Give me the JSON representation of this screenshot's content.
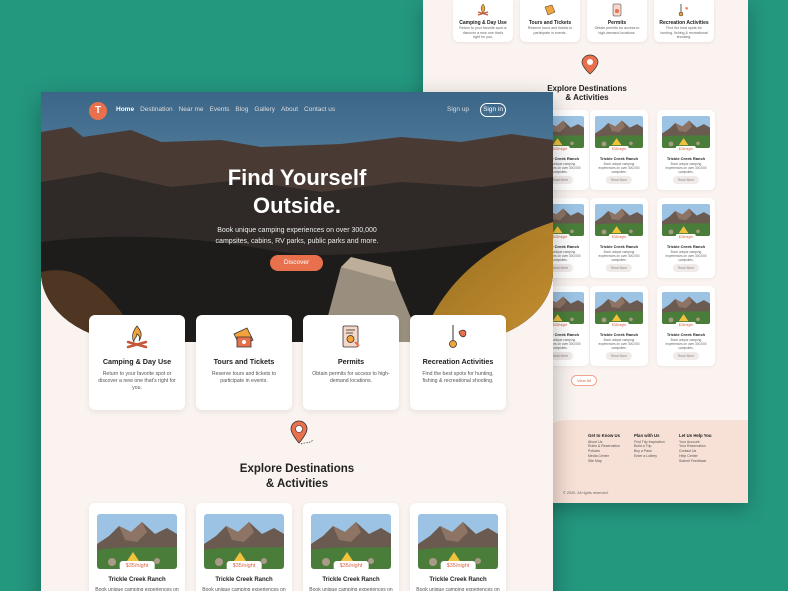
{
  "nav": {
    "logo_letter": "T",
    "items": [
      "Home",
      "Destination",
      "Near me",
      "Events",
      "Blog",
      "Gallery",
      "About",
      "Contact us"
    ],
    "sign_up": "Sign up",
    "sign_in": "Sign in"
  },
  "hero": {
    "title_line1": "Find Yourself",
    "title_line2": "Outside.",
    "subtitle": "Book unique camping experiences on over 300,000 campsites, cabins, RV parks, public parks and more.",
    "cta": "Discover"
  },
  "features": [
    {
      "title": "Camping & Day Use",
      "desc": "Return to your favorite spot or discover a new one that's right for you.",
      "icon": "campfire-icon"
    },
    {
      "title": "Tours and Tickets",
      "desc": "Reserve tours and tickets to participate in events.",
      "icon": "ticket-icon"
    },
    {
      "title": "Permits",
      "desc": "Obtain permits for access to high-demand locations.",
      "icon": "permit-icon"
    },
    {
      "title": "Recreation Activities",
      "desc": "Find the best spots for hunting, fishing & recreational shooting.",
      "icon": "fishing-icon"
    }
  ],
  "explore": {
    "title_line1": "Explore Destinations",
    "title_line2": "& Activities",
    "cards": [
      {
        "price": "$35/night",
        "name": "Trickle Creek Ranch",
        "desc": "Book unique camping experiences on"
      },
      {
        "price": "$35/night",
        "name": "Trickle Creek Ranch",
        "desc": "Book unique camping experiences on"
      },
      {
        "price": "$35/night",
        "name": "Trickle Creek Ranch",
        "desc": "Book unique camping experiences on"
      },
      {
        "price": "$35/night",
        "name": "Trickle Creek Ranch",
        "desc": "Book unique camping experiences on"
      }
    ]
  },
  "back_page": {
    "explore_title_line1": "Explore Destinations",
    "explore_title_line2": "& Activities",
    "card_price": "$35/night",
    "card_name": "Trickle Creek Ranch",
    "card_desc": "Book unique camping experiences on over 300,000 campsites.",
    "read_more": "Read More",
    "view_all": "View All",
    "footer": {
      "col1_title": "Get to Know Us",
      "col1_items": [
        "About Us",
        "Rules & Reservation",
        "Policies",
        "Media Center",
        "Site Map"
      ],
      "col2_title": "Plan with Us",
      "col2_items": [
        "Find Trip Inspiration",
        "Build a Trip",
        "Buy a Pass",
        "Enter a Lottery"
      ],
      "col3_title": "Let Us Help You",
      "col3_items": [
        "Your Account",
        "Your Reservation",
        "Contact Us",
        "Help Center",
        "Submit Feedback"
      ],
      "copyright": "© 2020. All rights reserved."
    }
  },
  "colors": {
    "accent": "#e9704c",
    "background": "#24977f",
    "page": "#faf3ef"
  }
}
